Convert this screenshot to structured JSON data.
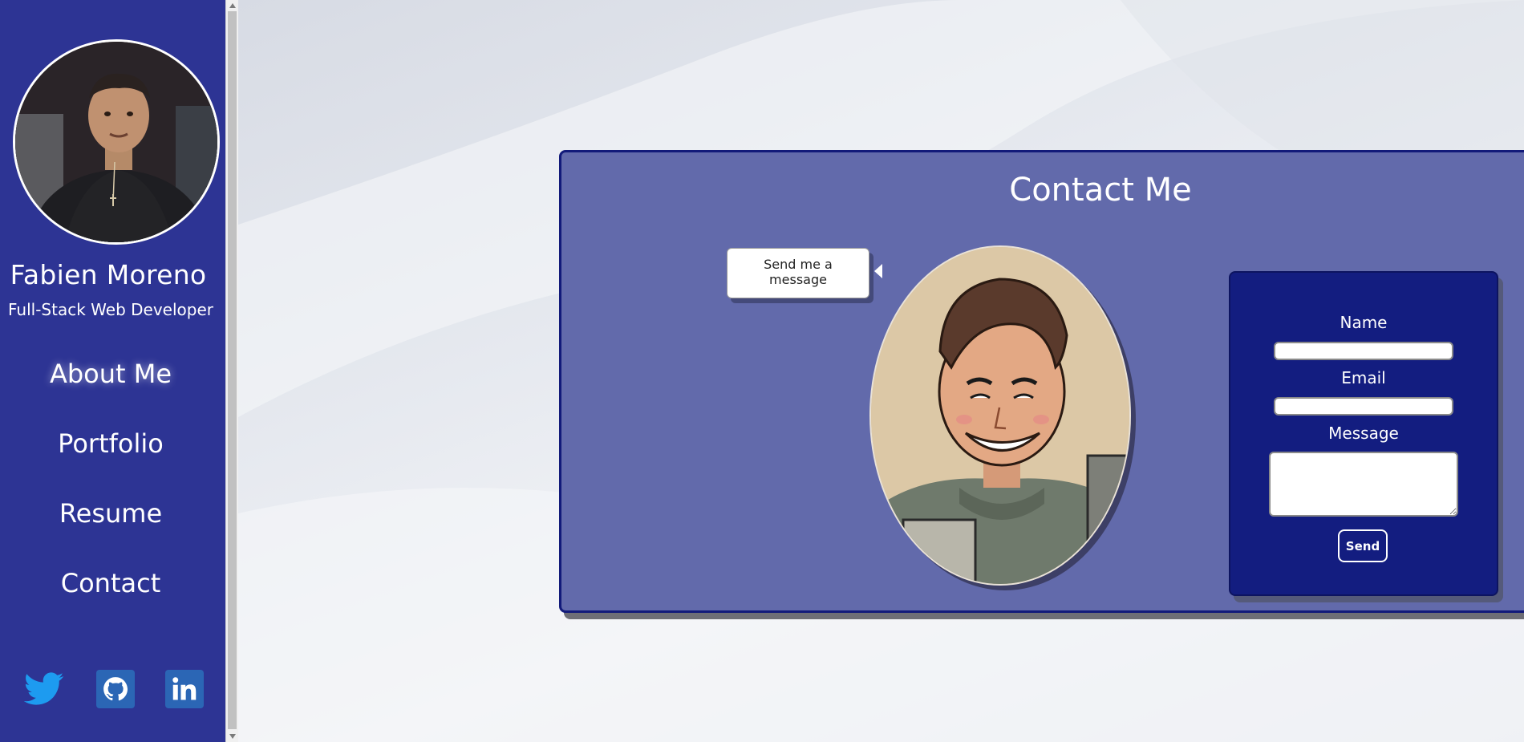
{
  "profile": {
    "name": "Fabien Moreno",
    "title": "Full-Stack Web Developer"
  },
  "nav": {
    "items": [
      {
        "label": "About Me",
        "active": true
      },
      {
        "label": "Portfolio"
      },
      {
        "label": "Resume"
      },
      {
        "label": "Contact"
      }
    ]
  },
  "socials": [
    {
      "icon": "twitter-icon",
      "color": "#1d9bf0"
    },
    {
      "icon": "github-icon",
      "color": "#2b66b5"
    },
    {
      "icon": "linkedin-icon",
      "color": "#2b66b5"
    }
  ],
  "contact": {
    "title": "Contact Me",
    "bubble_text": "Send me a message",
    "form": {
      "name_label": "Name",
      "email_label": "Email",
      "message_label": "Message",
      "name_value": "",
      "email_value": "",
      "message_value": "",
      "send_label": "Send"
    }
  },
  "colors": {
    "sidebar": "#2d3494",
    "card": "#626aab",
    "form_panel": "#131d80"
  }
}
